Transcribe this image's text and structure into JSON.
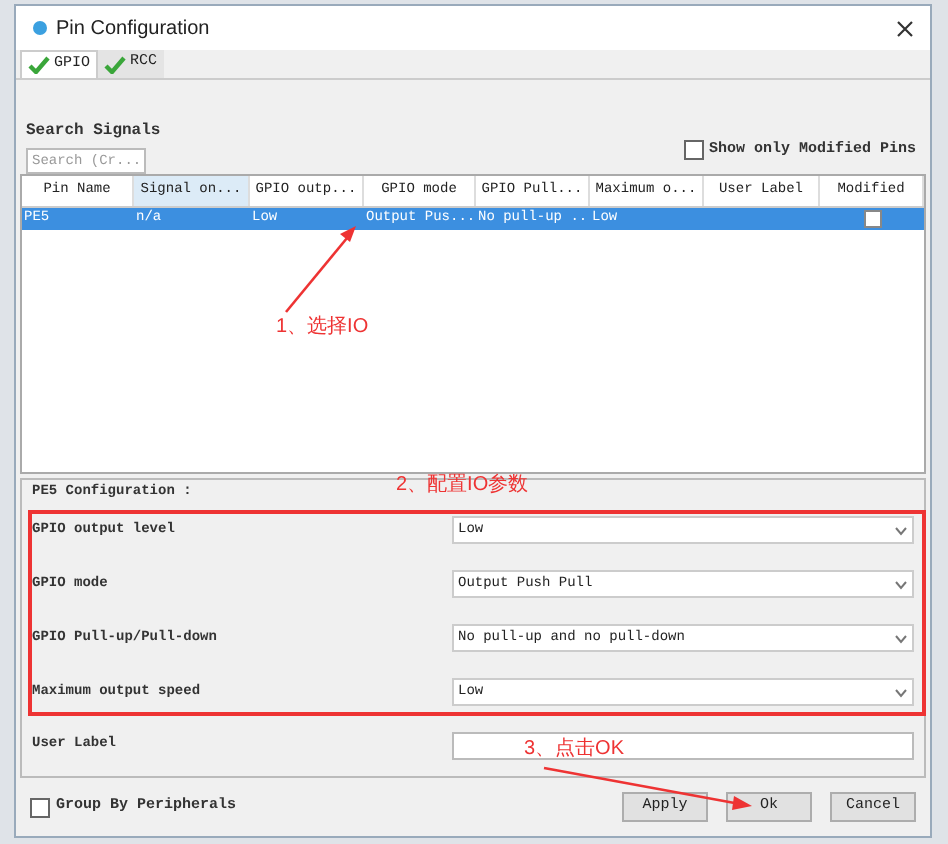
{
  "window": {
    "title": "Pin Configuration"
  },
  "tabs": [
    {
      "label": "GPIO",
      "selected": true
    },
    {
      "label": "RCC",
      "selected": false
    }
  ],
  "search": {
    "label": "Search Signals",
    "placeholder": "Search (Cr..."
  },
  "show_only_modified": {
    "label": "Show only Modified Pins",
    "checked": false
  },
  "table": {
    "columns": [
      "Pin Name",
      "Signal on...",
      "GPIO outp...",
      "GPIO mode",
      "GPIO Pull...",
      "Maximum o...",
      "User Label",
      "Modified"
    ],
    "rows": [
      {
        "cells": [
          "PE5",
          "n/a",
          "Low",
          "Output Pus...",
          "No pull-up ...",
          "Low",
          ""
        ],
        "modified": false,
        "selected": true
      }
    ]
  },
  "configuration": {
    "title": "PE5 Configuration :",
    "settings": [
      {
        "label": "GPIO output level",
        "value": "Low"
      },
      {
        "label": "GPIO mode",
        "value": "Output Push Pull"
      },
      {
        "label": "GPIO Pull-up/Pull-down",
        "value": "No pull-up and no pull-down"
      },
      {
        "label": "Maximum output speed",
        "value": "Low"
      }
    ],
    "user_label": {
      "label": "User Label"
    }
  },
  "group_by_peripherals": {
    "label": "Group By Peripherals",
    "checked": false
  },
  "buttons": [
    "Apply",
    "Ok",
    "Cancel"
  ],
  "annotations": [
    "1、选择IO",
    "2、配置IO参数",
    "3、点击OK"
  ]
}
